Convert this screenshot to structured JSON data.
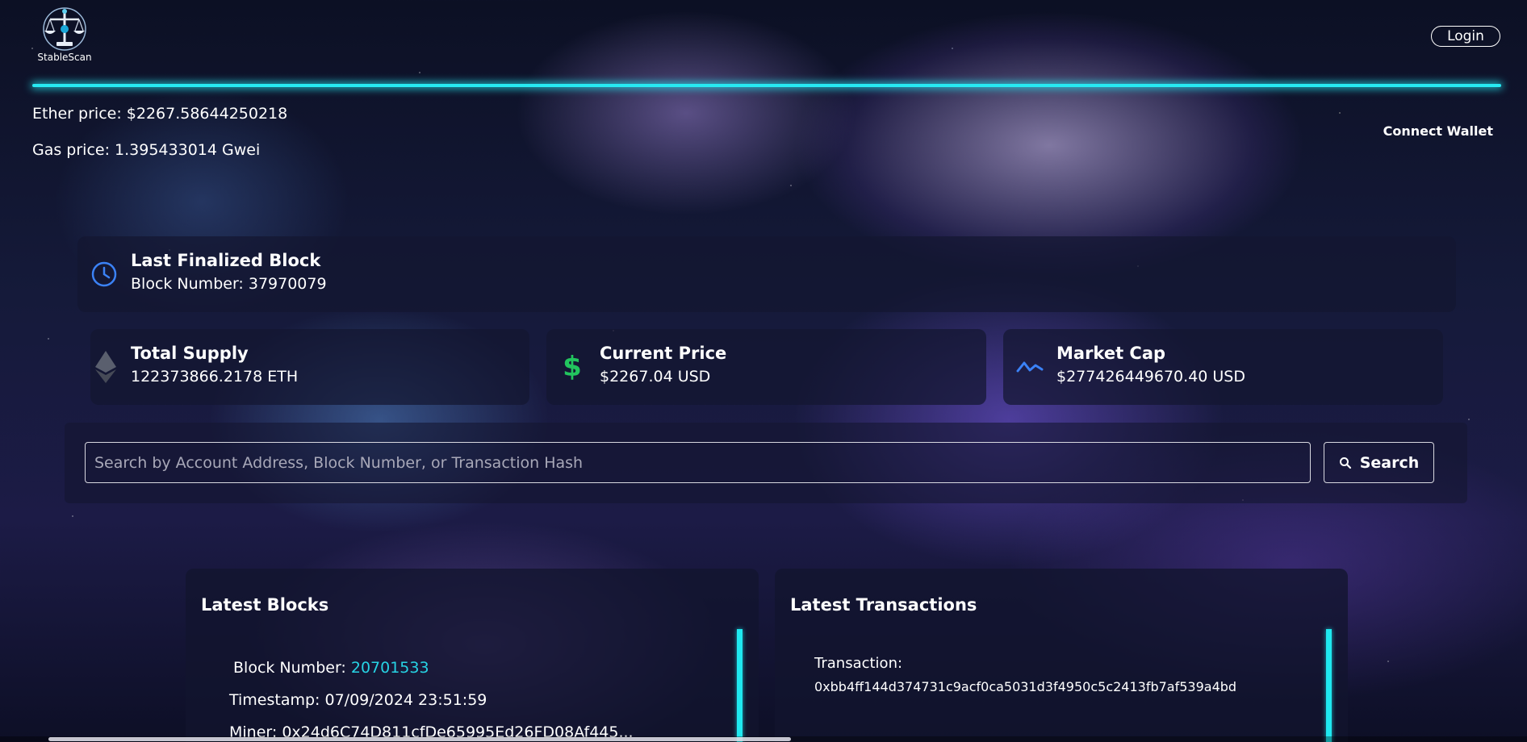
{
  "header": {
    "logo_text": "StableScan",
    "login_label": "Login",
    "connect_wallet_label": "Connect Wallet"
  },
  "market": {
    "ether_price": "Ether price: $2267.58644250218",
    "gas_price": "Gas price: 1.395433014 Gwei"
  },
  "last_block": {
    "title": "Last Finalized Block",
    "value": "Block Number: 37970079",
    "icon": "clock-icon"
  },
  "stats": [
    {
      "title": "Total Supply",
      "value": "122373866.2178 ETH",
      "icon": "ethereum-icon"
    },
    {
      "title": "Current Price",
      "value": "$2267.04 USD",
      "icon": "dollar-icon"
    },
    {
      "title": "Market Cap",
      "value": "$277426449670.40 USD",
      "icon": "trend-line-icon"
    }
  ],
  "search": {
    "placeholder": "Search by Account Address, Block Number, or Transaction Hash",
    "button_label": "Search"
  },
  "latest_blocks": {
    "title": "Latest Blocks",
    "items": [
      {
        "block_label": "Block Number: ",
        "block_number": "20701533",
        "timestamp": "Timestamp: 07/09/2024 23:51:59",
        "miner": "Miner: 0x24d6C74D811cfDe65995Ed26FD08Af445..."
      }
    ]
  },
  "latest_transactions": {
    "title": "Latest Transactions",
    "items": [
      {
        "label": "Transaction:",
        "hash": "0xbb4ff144d374731c9acf0ca5031d3f4950c5c2413fb7af539a4bd"
      }
    ]
  },
  "colors": {
    "accent_cyan": "#27e9f2",
    "link": "#27d3e4",
    "dollar_green": "#22c55e",
    "clock_blue": "#3b82f6",
    "trend_blue": "#3b82f6"
  }
}
